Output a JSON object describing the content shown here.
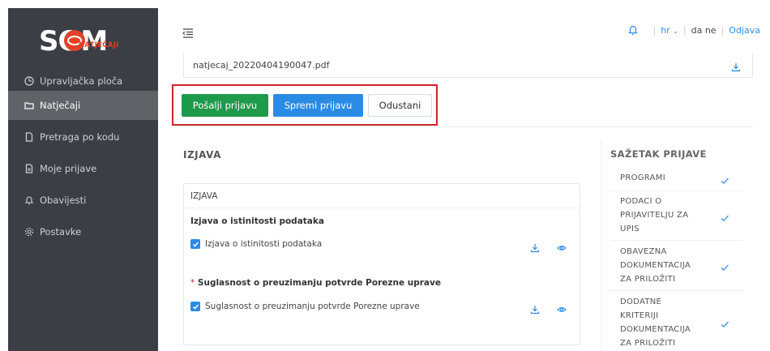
{
  "brand": {
    "logo_text": "SOM",
    "logo_subtitle": "NATJEČAJI"
  },
  "sidebar": {
    "items": [
      {
        "label": "Upravljačka ploča",
        "icon": "dashboard-icon"
      },
      {
        "label": "Natječaji",
        "icon": "folder-icon",
        "active": true
      },
      {
        "label": "Pretraga po kodu",
        "icon": "document-icon"
      },
      {
        "label": "Moje prijave",
        "icon": "document-icon"
      },
      {
        "label": "Obavijesti",
        "icon": "bell-icon"
      },
      {
        "label": "Postavke",
        "icon": "gear-icon"
      }
    ]
  },
  "topbar": {
    "language": "hr",
    "user": "da ne",
    "logout": "Odjava"
  },
  "file": {
    "name": "natjecaj_20220404190047.pdf"
  },
  "actions": {
    "send": "Pošalji prijavu",
    "save": "Spremi prijavu",
    "cancel": "Odustani"
  },
  "izjava": {
    "section_title": "IZJAVA",
    "card_header": "IZJAVA",
    "items": [
      {
        "title": "Izjava o istinitosti podataka",
        "required": false,
        "checkbox_label": "Izjava o istinitosti podataka",
        "checked": true
      },
      {
        "title": "Suglasnost o preuzimanju potvrde Porezne uprave",
        "required": true,
        "required_mark": "*",
        "checkbox_label": "Suglasnost o preuzimanju potvrde Porezne uprave",
        "checked": true
      }
    ]
  },
  "summary": {
    "title": "SAŽETAK PRIJAVE",
    "items": [
      {
        "label": "PROGRAMI",
        "done": true
      },
      {
        "label": "PODACI O\nPRIJAVITELJU ZA\nUPIS",
        "done": true
      },
      {
        "label": "OBAVEZNA\nDOKUMENTACIJA\nZA PRILOŽITI",
        "done": true
      },
      {
        "label": "DODATNE\nKRITERIJI\nDOKUMENTACIJA\nZA PRILOŽITI",
        "done": true
      }
    ]
  },
  "colors": {
    "sidebar_bg": "#3b3e44",
    "sidebar_active": "#5f6368",
    "accent_blue": "#2a8be5",
    "send_green": "#1e9a4b",
    "highlight_red": "#d0242c",
    "logo_red": "#e2412a"
  }
}
